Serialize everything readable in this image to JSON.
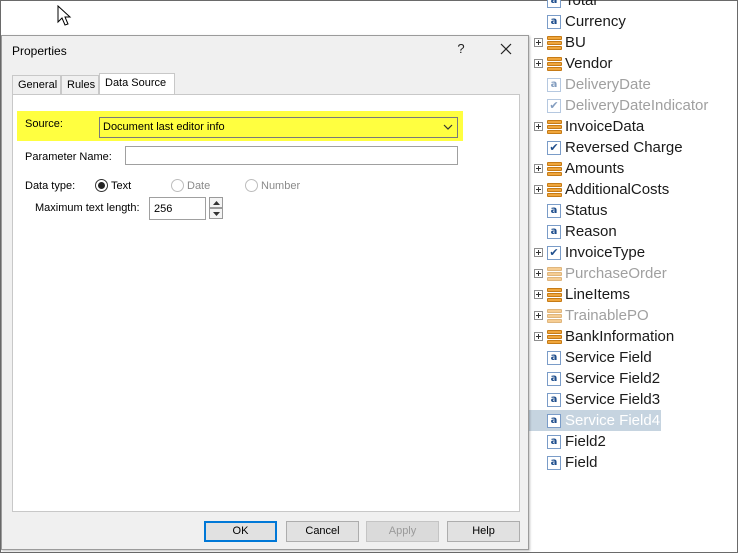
{
  "dialog": {
    "title": "Properties",
    "help_glyph": "?",
    "tabs": [
      "General",
      "Rules",
      "Data Source"
    ],
    "active_tab": "Data Source",
    "source_label": "Source:",
    "source_value": "Document last editor info",
    "parameter_name_label": "Parameter Name:",
    "parameter_name_value": "",
    "data_type_label": "Data type:",
    "data_type_options": [
      "Text",
      "Date",
      "Number"
    ],
    "data_type_selected": "Text",
    "max_length_label": "Maximum text length:",
    "max_length_value": "256",
    "buttons": {
      "ok": "OK",
      "cancel": "Cancel",
      "apply": "Apply",
      "help": "Help"
    }
  },
  "tree": {
    "items": [
      {
        "label": "Total",
        "icon": "text-field-icon",
        "expandable": false,
        "dim": false
      },
      {
        "label": "Currency",
        "icon": "text-field-icon",
        "expandable": false,
        "dim": false
      },
      {
        "label": "BU",
        "icon": "group-icon",
        "expandable": true,
        "dim": false
      },
      {
        "label": "Vendor",
        "icon": "group-icon",
        "expandable": true,
        "dim": false
      },
      {
        "label": "DeliveryDate",
        "icon": "text-field-icon",
        "expandable": false,
        "dim": true
      },
      {
        "label": "DeliveryDateIndicator",
        "icon": "checkbox-field-icon",
        "expandable": false,
        "dim": true
      },
      {
        "label": "InvoiceData",
        "icon": "group-icon",
        "expandable": true,
        "dim": false
      },
      {
        "label": "Reversed Charge",
        "icon": "checkbox-field-icon",
        "expandable": false,
        "dim": false
      },
      {
        "label": "Amounts",
        "icon": "group-icon",
        "expandable": true,
        "dim": false
      },
      {
        "label": "AdditionalCosts",
        "icon": "group-icon",
        "expandable": true,
        "dim": false
      },
      {
        "label": "Status",
        "icon": "text-field-icon",
        "expandable": false,
        "dim": false
      },
      {
        "label": "Reason",
        "icon": "text-field-icon",
        "expandable": false,
        "dim": false
      },
      {
        "label": "InvoiceType",
        "icon": "checkbox-field-icon",
        "expandable": true,
        "dim": false
      },
      {
        "label": "PurchaseOrder",
        "icon": "group-icon",
        "expandable": true,
        "dim": true
      },
      {
        "label": "LineItems",
        "icon": "group-icon",
        "expandable": true,
        "dim": false
      },
      {
        "label": "TrainablePO",
        "icon": "group-icon",
        "expandable": true,
        "dim": true
      },
      {
        "label": "BankInformation",
        "icon": "group-icon",
        "expandable": true,
        "dim": false
      },
      {
        "label": "Service Field",
        "icon": "text-field-icon",
        "expandable": false,
        "dim": false
      },
      {
        "label": "Service Field2",
        "icon": "text-field-icon",
        "expandable": false,
        "dim": false
      },
      {
        "label": "Service Field3",
        "icon": "text-field-icon",
        "expandable": false,
        "dim": false
      },
      {
        "label": "Service Field4",
        "icon": "text-field-icon",
        "expandable": false,
        "dim": false,
        "selected": true
      },
      {
        "label": "Field2",
        "icon": "text-field-icon",
        "expandable": false,
        "dim": false
      },
      {
        "label": "Field",
        "icon": "text-field-icon",
        "expandable": false,
        "dim": false
      }
    ]
  }
}
